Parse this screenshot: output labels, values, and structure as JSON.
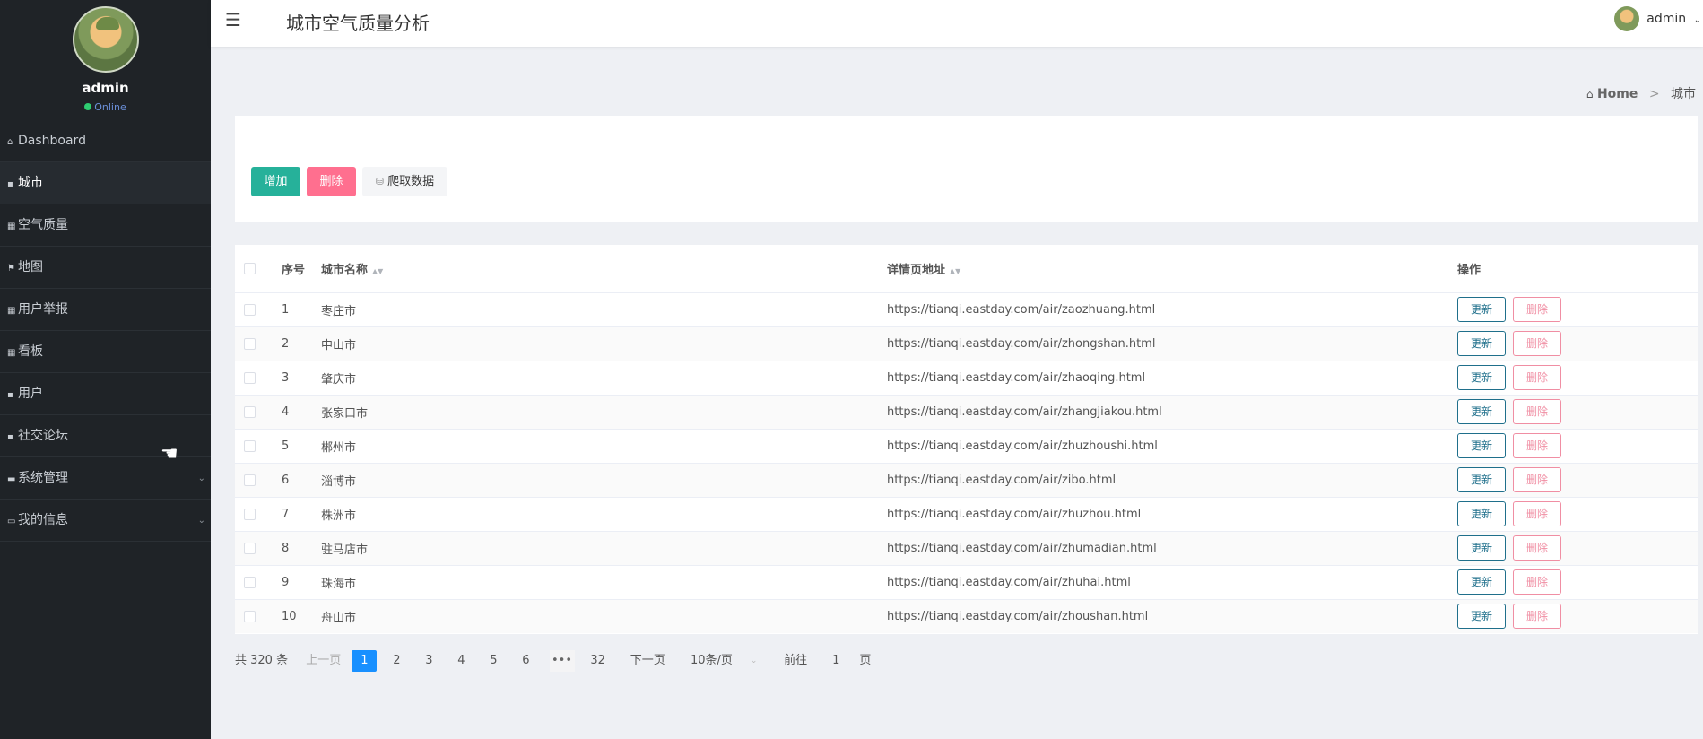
{
  "app": {
    "title": "城市空气质量分析"
  },
  "user": {
    "name": "admin",
    "status": "Online"
  },
  "topbar": {
    "user_label": "admin"
  },
  "sidebar": {
    "items": [
      {
        "label": "Dashboard",
        "icon": "home-icon",
        "glyph": "⌂"
      },
      {
        "label": "城市",
        "icon": "monitor-icon",
        "glyph": "▪",
        "active": true
      },
      {
        "label": "空气质量",
        "icon": "grid-icon",
        "glyph": "▦"
      },
      {
        "label": "地图",
        "icon": "flag-icon",
        "glyph": "⚑"
      },
      {
        "label": "用户举报",
        "icon": "grid-icon",
        "glyph": "▦"
      },
      {
        "label": "看板",
        "icon": "grid-icon",
        "glyph": "▦"
      },
      {
        "label": "用户",
        "icon": "chat-icon",
        "glyph": "▪"
      },
      {
        "label": "社交论坛",
        "icon": "doc-icon",
        "glyph": "▪"
      },
      {
        "label": "系统管理",
        "icon": "settings-icon",
        "glyph": "▬",
        "expandable": true
      },
      {
        "label": "我的信息",
        "icon": "card-icon",
        "glyph": "▭",
        "expandable": true
      }
    ]
  },
  "breadcrumb": {
    "home": "Home",
    "sep": ">",
    "current": "城市"
  },
  "toolbar": {
    "add_label": "增加",
    "delete_label": "删除",
    "crawl_label": "爬取数据"
  },
  "table": {
    "headers": {
      "index": "序号",
      "name": "城市名称",
      "url": "详情页地址",
      "actions": "操作"
    },
    "rows": [
      {
        "index": "1",
        "name": "枣庄市",
        "url": "https://tianqi.eastday.com/air/zaozhuang.html"
      },
      {
        "index": "2",
        "name": "中山市",
        "url": "https://tianqi.eastday.com/air/zhongshan.html"
      },
      {
        "index": "3",
        "name": "肇庆市",
        "url": "https://tianqi.eastday.com/air/zhaoqing.html"
      },
      {
        "index": "4",
        "name": "张家口市",
        "url": "https://tianqi.eastday.com/air/zhangjiakou.html"
      },
      {
        "index": "5",
        "name": "郴州市",
        "url": "https://tianqi.eastday.com/air/zhuzhoushi.html"
      },
      {
        "index": "6",
        "name": "淄博市",
        "url": "https://tianqi.eastday.com/air/zibo.html"
      },
      {
        "index": "7",
        "name": "株洲市",
        "url": "https://tianqi.eastday.com/air/zhuzhou.html"
      },
      {
        "index": "8",
        "name": "驻马店市",
        "url": "https://tianqi.eastday.com/air/zhumadian.html"
      },
      {
        "index": "9",
        "name": "珠海市",
        "url": "https://tianqi.eastday.com/air/zhuhai.html"
      },
      {
        "index": "10",
        "name": "舟山市",
        "url": "https://tianqi.eastday.com/air/zhoushan.html"
      }
    ],
    "update_label": "更新",
    "delete_label": "删除"
  },
  "pagination": {
    "total": "共 320 条",
    "prev": "上一页",
    "pages": [
      "1",
      "2",
      "3",
      "4",
      "5",
      "6"
    ],
    "current": "1",
    "more": "•••",
    "last": "32",
    "next": "下一页",
    "page_size": "10条/页",
    "goto_label": "前往",
    "goto_value": "1",
    "goto_suffix": "页"
  }
}
